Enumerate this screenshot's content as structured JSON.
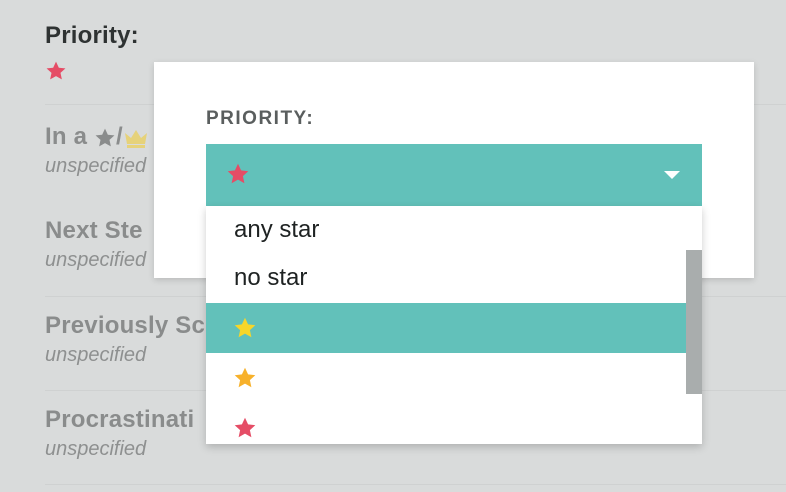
{
  "form": {
    "priority": {
      "label": "Priority:",
      "star_color": "#e54d66"
    },
    "in_a": {
      "label_prefix": "In a",
      "label_slash": "/",
      "value": "unspecified"
    },
    "next_step": {
      "label": "Next Ste",
      "value": "unspecified"
    },
    "previously": {
      "label": "Previously Sc",
      "value": "unspecified"
    },
    "procrastination": {
      "label": "Procrastinati",
      "value": "unspecified"
    }
  },
  "modal": {
    "label": "PRIORITY:",
    "selected_icon": "red-star-icon",
    "accent_color": "#62c1ba"
  },
  "dropdown": {
    "options": [
      {
        "label": "any star"
      },
      {
        "label": "no star"
      },
      {
        "icon": "yellow-star-icon",
        "color": "#f7d629",
        "selected": true
      },
      {
        "icon": "orange-star-icon",
        "color": "#f7b12b"
      },
      {
        "icon": "red-star-icon",
        "color": "#e54d66"
      }
    ]
  }
}
